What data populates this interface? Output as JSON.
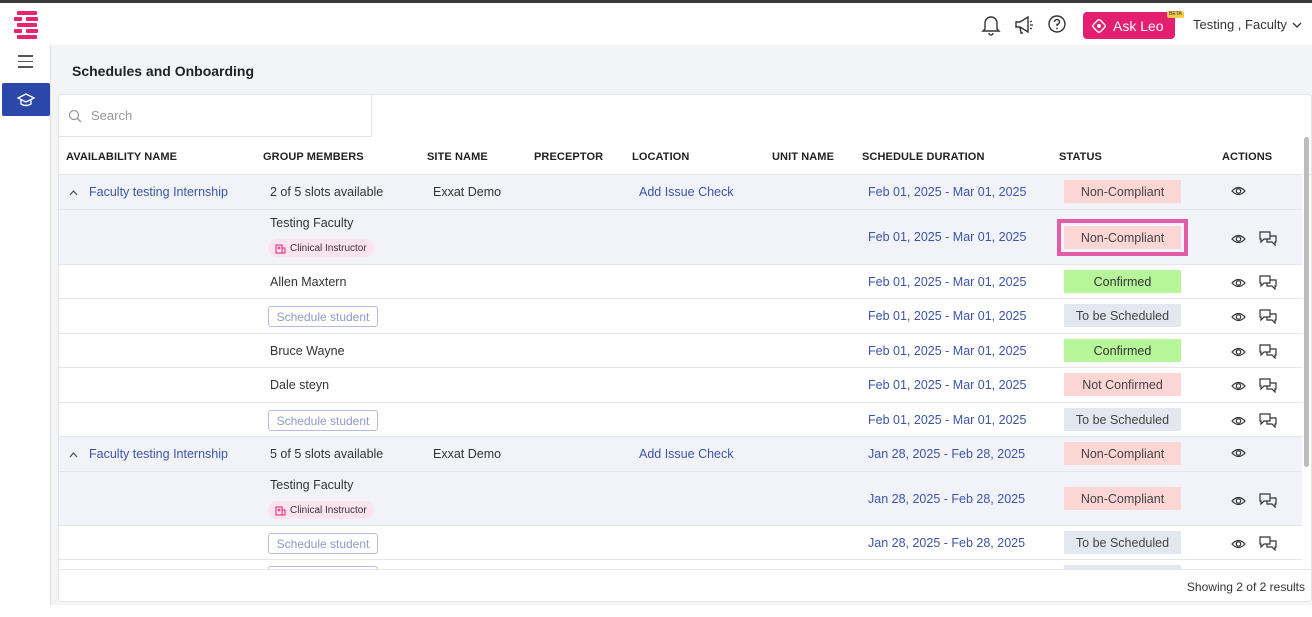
{
  "app": {
    "ask_leo": "Ask Leo",
    "beta": "BETA",
    "user": "Testing , Faculty",
    "page_title": "Schedules and Onboarding"
  },
  "search": {
    "placeholder": "Search"
  },
  "columns": {
    "availability": "AVAILABILITY NAME",
    "members": "GROUP MEMBERS",
    "site": "SITE NAME",
    "preceptor": "PRECEPTOR",
    "location": "LOCATION",
    "unit": "UNIT NAME",
    "duration": "SCHEDULE DURATION",
    "status": "STATUS",
    "actions": "ACTIONS"
  },
  "groups": [
    {
      "availability": "Faculty testing Internship",
      "slots": "2 of 5 slots available",
      "site": "Exxat Demo",
      "location": "Add Issue Check",
      "duration": "Feb 01, 2025 - Mar 01, 2025",
      "status": "Non-Compliant",
      "members": [
        {
          "name": "Testing Faculty",
          "role": "Clinical Instructor",
          "duration": "Feb 01, 2025 - Mar 01, 2025",
          "status": "Non-Compliant"
        },
        {
          "name": "Allen Maxtern",
          "duration": "Feb 01, 2025 - Mar 01, 2025",
          "status": "Confirmed"
        },
        {
          "button": "Schedule student",
          "duration": "Feb 01, 2025 - Mar 01, 2025",
          "status": "To be Scheduled"
        },
        {
          "name": "Bruce Wayne",
          "duration": "Feb 01, 2025 - Mar 01, 2025",
          "status": "Confirmed"
        },
        {
          "name": "Dale steyn",
          "duration": "Feb 01, 2025 - Mar 01, 2025",
          "status": "Not Confirmed"
        },
        {
          "button": "Schedule student",
          "duration": "Feb 01, 2025 - Mar 01, 2025",
          "status": "To be Scheduled"
        }
      ]
    },
    {
      "availability": "Faculty testing Internship",
      "slots": "5 of 5 slots available",
      "site": "Exxat Demo",
      "location": "Add Issue Check",
      "duration": "Jan 28, 2025 - Feb 28, 2025",
      "status": "Non-Compliant",
      "members": [
        {
          "name": "Testing Faculty",
          "role": "Clinical Instructor",
          "duration": "Jan 28, 2025 - Feb 28, 2025",
          "status": "Non-Compliant"
        },
        {
          "button": "Schedule student",
          "duration": "Jan 28, 2025 - Feb 28, 2025",
          "status": "To be Scheduled"
        }
      ]
    }
  ],
  "footer": {
    "results": "Showing 2 of 2 results"
  },
  "colors": {
    "brand": "#e41e71",
    "link": "#3d55a8",
    "nav_active": "#2b47a8",
    "highlight": "#e25ba6"
  },
  "icons": [
    "bell-icon",
    "megaphone-icon",
    "help-icon",
    "leo-icon",
    "chevron-down-icon",
    "menu-icon",
    "graduation-cap-icon",
    "search-icon",
    "chevron-up-icon",
    "eye-icon",
    "chat-icon",
    "hospital-icon"
  ]
}
